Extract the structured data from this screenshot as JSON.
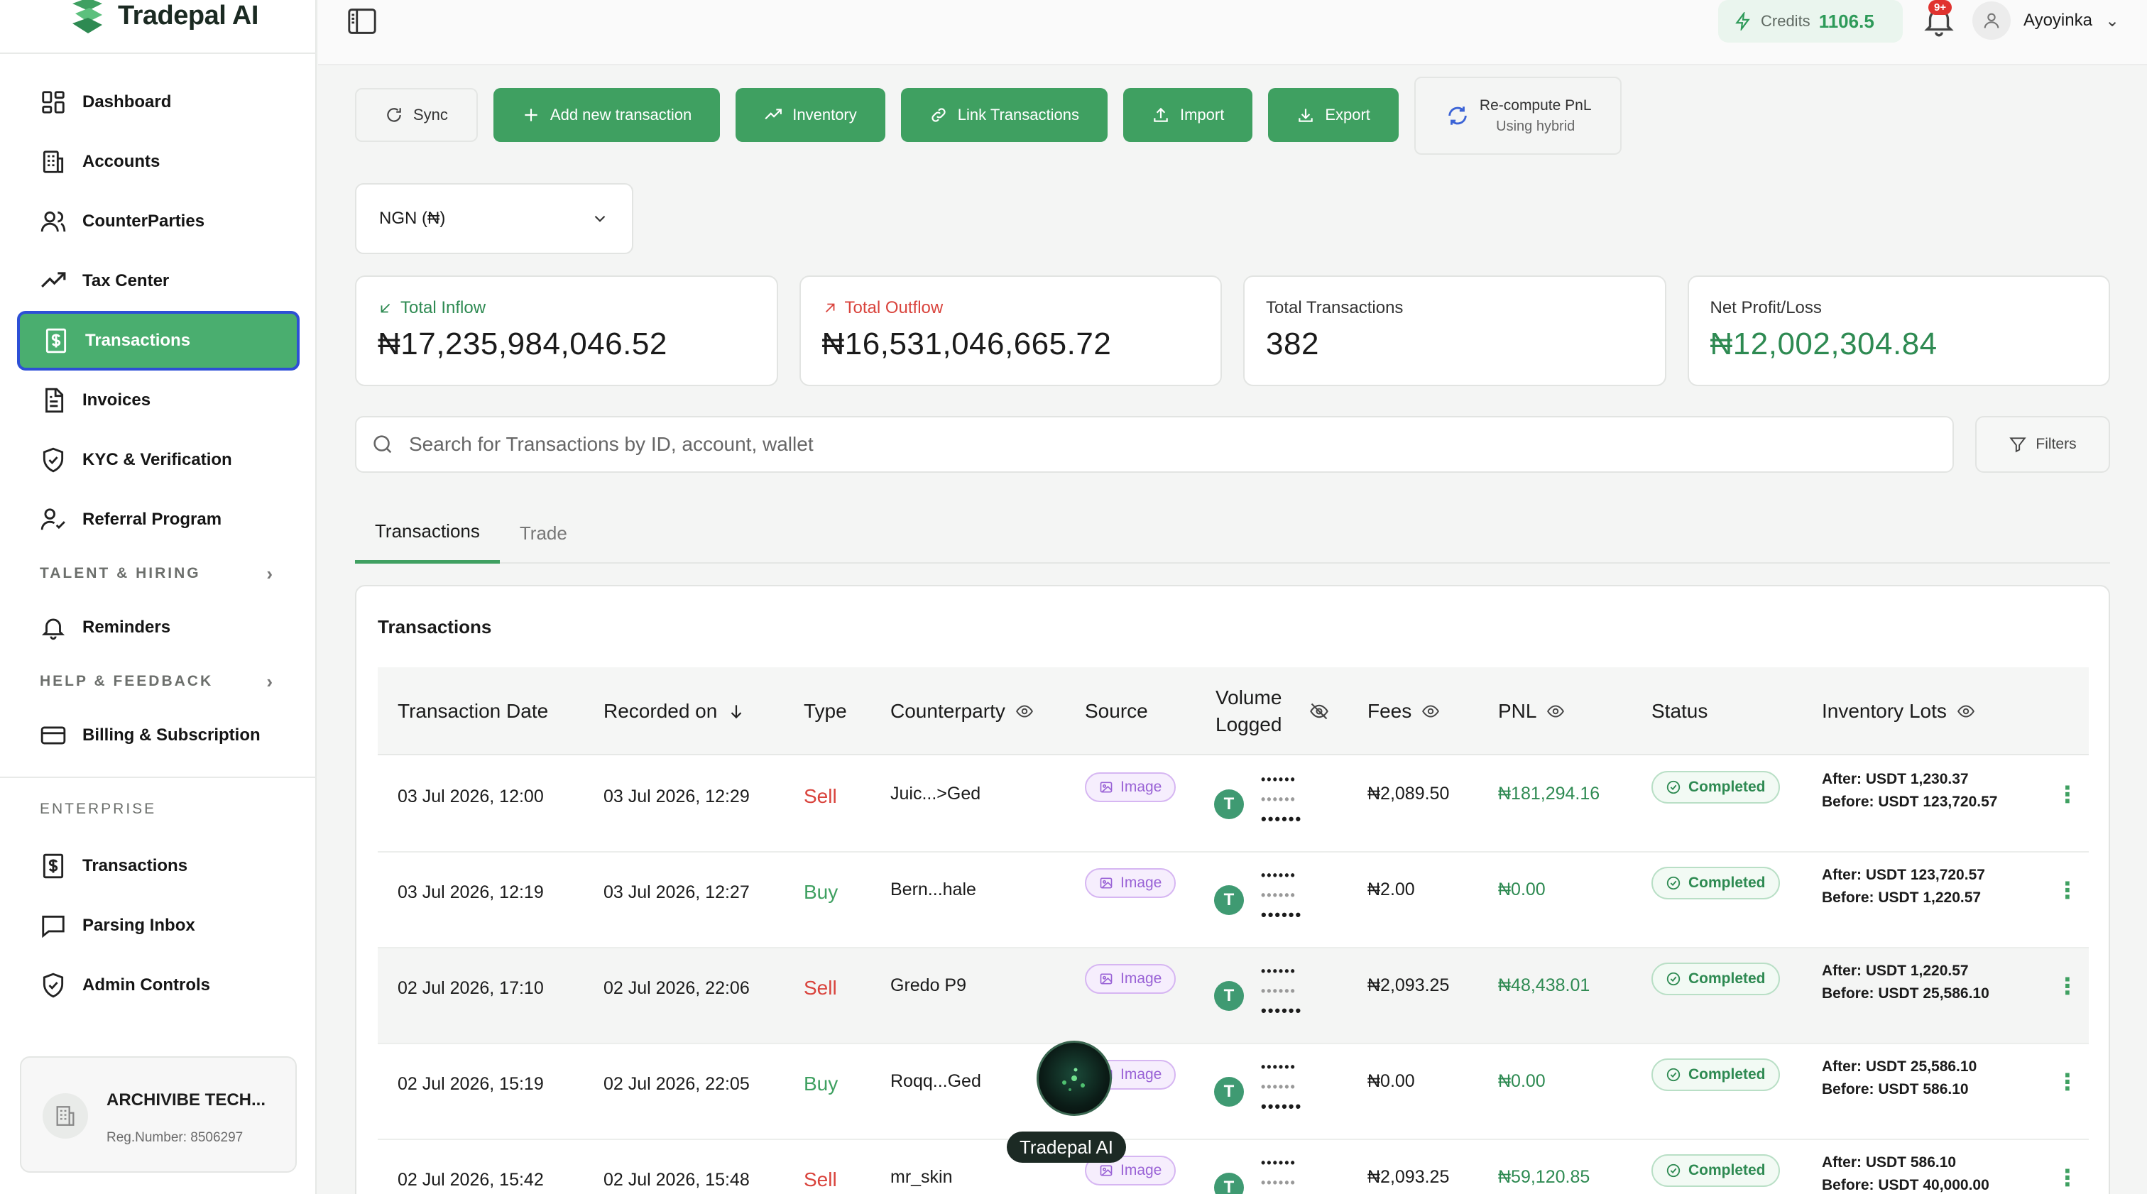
{
  "app": {
    "name": "Tradepal AI"
  },
  "sidebar": {
    "nav": [
      {
        "label": "Dashboard",
        "icon": "dashboard-icon"
      },
      {
        "label": "Accounts",
        "icon": "bank-icon"
      },
      {
        "label": "CounterParties",
        "icon": "users-icon"
      },
      {
        "label": "Tax Center",
        "icon": "trending-up-icon"
      },
      {
        "label": "Transactions",
        "icon": "dollar-doc-icon",
        "active": true
      },
      {
        "label": "Invoices",
        "icon": "invoice-icon"
      },
      {
        "label": "KYC & Verification",
        "icon": "shield-check-icon"
      },
      {
        "label": "Referral Program",
        "icon": "user-check-icon"
      }
    ],
    "section_talent": "TALENT & HIRING",
    "reminders": "Reminders",
    "section_help": "HELP & FEEDBACK",
    "billing": "Billing & Subscription",
    "enterprise_label": "ENTERPRISE",
    "enterprise_nav": [
      {
        "label": "Transactions"
      },
      {
        "label": "Parsing Inbox"
      },
      {
        "label": "Admin Controls"
      }
    ],
    "org": {
      "name": "ARCHIVIBE TECH...",
      "reg": "Reg.Number: 8506297"
    }
  },
  "topbar": {
    "credits_label": "Credits",
    "credits_value": "1106.5",
    "notif_badge": "9+",
    "username": "Ayoyinka"
  },
  "toolbar": {
    "sync": "Sync",
    "add": "Add new transaction",
    "inventory": "Inventory",
    "link": "Link Transactions",
    "import": "Import",
    "export": "Export",
    "recompute": "Re-compute PnL",
    "recompute_sub": "Using hybrid"
  },
  "currency": {
    "selected": "NGN (₦)"
  },
  "stats": {
    "inflow_label": "Total Inflow",
    "inflow_value": "₦17,235,984,046.52",
    "outflow_label": "Total Outflow",
    "outflow_value": "₦16,531,046,665.72",
    "count_label": "Total Transactions",
    "count_value": "382",
    "pnl_label": "Net Profit/Loss",
    "pnl_value": "₦12,002,304.84"
  },
  "search": {
    "placeholder": "Search for Transactions by ID, account, wallet"
  },
  "filters_label": "Filters",
  "tabs": [
    "Transactions",
    "Trade"
  ],
  "table": {
    "title": "Transactions",
    "columns": {
      "date": "Transaction Date",
      "recorded": "Recorded on",
      "type": "Type",
      "counterparty": "Counterparty",
      "source": "Source",
      "volume1": "Volume",
      "volume2": "Logged",
      "fees": "Fees",
      "pnl": "PNL",
      "status": "Status",
      "lots": "Inventory Lots"
    },
    "masked": "••••••",
    "usdt_symbol": "T",
    "rows": [
      {
        "date": "03 Jul 2026, 12:00",
        "recorded": "03 Jul 2026, 12:29",
        "type": "Sell",
        "counterparty": "Juic...>Ged",
        "source": "Image",
        "fees": "₦2,089.50",
        "pnl": "₦181,294.16",
        "status": "Completed",
        "after": "After: USDT 1,230.37",
        "before": "Before: USDT 123,720.57"
      },
      {
        "date": "03 Jul 2026, 12:19",
        "recorded": "03 Jul 2026, 12:27",
        "type": "Buy",
        "counterparty": "Bern...hale",
        "source": "Image",
        "fees": "₦2.00",
        "pnl": "₦0.00",
        "status": "Completed",
        "after": "After: USDT 123,720.57",
        "before": "Before: USDT 1,220.57"
      },
      {
        "date": "02 Jul 2026, 17:10",
        "recorded": "02 Jul 2026, 22:06",
        "type": "Sell",
        "counterparty": "Gredo P9",
        "source": "Image",
        "fees": "₦2,093.25",
        "pnl": "₦48,438.01",
        "status": "Completed",
        "after": "After: USDT 1,220.57",
        "before": "Before: USDT 25,586.10"
      },
      {
        "date": "02 Jul 2026, 15:19",
        "recorded": "02 Jul 2026, 22:05",
        "type": "Buy",
        "counterparty": "Roqq...Ged",
        "source": "Image",
        "fees": "₦0.00",
        "pnl": "₦0.00",
        "status": "Completed",
        "after": "After: USDT 25,586.10",
        "before": "Before: USDT 586.10"
      },
      {
        "date": "02 Jul 2026, 15:42",
        "recorded": "02 Jul 2026, 15:48",
        "type": "Sell",
        "counterparty": "mr_skin",
        "source": "Image",
        "fees": "₦2,093.25",
        "pnl": "₦59,120.85",
        "status": "Completed",
        "after": "After: USDT 586.10",
        "before": "Before: USDT 40,000.00"
      }
    ]
  },
  "assistant": {
    "label": "Tradepal AI"
  }
}
